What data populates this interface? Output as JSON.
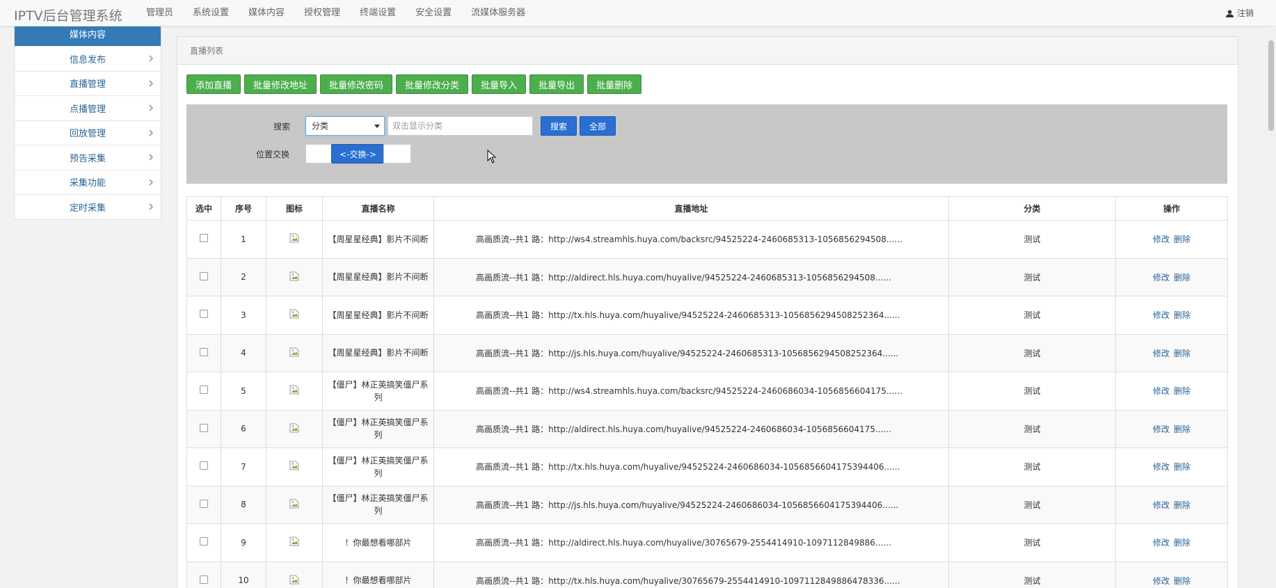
{
  "app": {
    "title": "IPTV后台管理系统"
  },
  "nav": {
    "items": [
      "管理员",
      "系统设置",
      "媒体内容",
      "授权管理",
      "终端设置",
      "安全设置",
      "流媒体服务器"
    ],
    "logout": "注销"
  },
  "sidebar": {
    "header": "媒体内容",
    "items": [
      "信息发布",
      "直播管理",
      "点播管理",
      "回放管理",
      "预告采集",
      "采集功能",
      "定时采集"
    ]
  },
  "panel": {
    "title": "直播列表"
  },
  "toolbar": {
    "buttons": [
      "添加直播",
      "批量修改地址",
      "批量修改密码",
      "批量修改分类",
      "批量导入",
      "批量导出",
      "批量删除"
    ]
  },
  "search": {
    "label": "搜索",
    "select_value": "分类",
    "placeholder": "双击显示分类",
    "search_btn": "搜索",
    "all_btn": "全部",
    "swap_label": "位置交换",
    "swap_btn": "<-交换->"
  },
  "table": {
    "headers": [
      "选中",
      "序号",
      "图标",
      "直播名称",
      "直播地址",
      "分类",
      "操作"
    ],
    "edit_label": "修改",
    "delete_label": "删除",
    "rows": [
      {
        "no": "1",
        "name": "【周星星经典】影片不间断",
        "url": "高画质流--共1 路：http://ws4.streamhls.huya.com/backsrc/94525224-2460685313-1056856294508......",
        "category": "测试"
      },
      {
        "no": "2",
        "name": "【周星星经典】影片不间断",
        "url": "高画质流--共1 路：http://aldirect.hls.huya.com/huyalive/94525224-2460685313-1056856294508......",
        "category": "测试"
      },
      {
        "no": "3",
        "name": "【周星星经典】影片不间断",
        "url": "高画质流--共1 路：http://tx.hls.huya.com/huyalive/94525224-2460685313-1056856294508252364......",
        "category": "测试"
      },
      {
        "no": "4",
        "name": "【周星星经典】影片不间断",
        "url": "高画质流--共1 路：http://js.hls.huya.com/huyalive/94525224-2460685313-1056856294508252364......",
        "category": "测试"
      },
      {
        "no": "5",
        "name": "【僵尸】林正英搞笑僵尸系列",
        "url": "高画质流--共1 路：http://ws4.streamhls.huya.com/backsrc/94525224-2460686034-1056856604175......",
        "category": "测试"
      },
      {
        "no": "6",
        "name": "【僵尸】林正英搞笑僵尸系列",
        "url": "高画质流--共1 路：http://aldirect.hls.huya.com/huyalive/94525224-2460686034-1056856604175......",
        "category": "测试"
      },
      {
        "no": "7",
        "name": "【僵尸】林正英搞笑僵尸系列",
        "url": "高画质流--共1 路：http://tx.hls.huya.com/huyalive/94525224-2460686034-1056856604175394406......",
        "category": "测试"
      },
      {
        "no": "8",
        "name": "【僵尸】林正英搞笑僵尸系列",
        "url": "高画质流--共1 路：http://js.hls.huya.com/huyalive/94525224-2460686034-1056856604175394406......",
        "category": "测试"
      },
      {
        "no": "9",
        "name": "！你最想看哪部片",
        "url": "高画质流--共1 路：http://aldirect.hls.huya.com/huyalive/30765679-2554414910-1097112849886......",
        "category": "测试"
      },
      {
        "no": "10",
        "name": "！你最想看哪部片",
        "url": "高画质流--共1 路：http://tx.hls.huya.com/huyalive/30765679-2554414910-1097112849886478336......",
        "category": "测试"
      }
    ]
  }
}
